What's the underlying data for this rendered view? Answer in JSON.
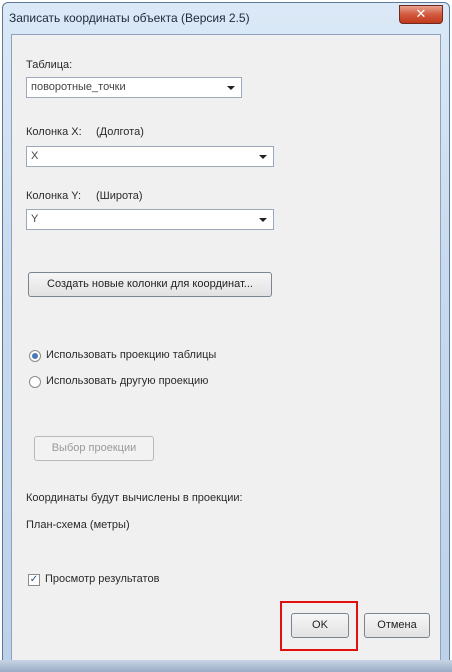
{
  "window": {
    "title": "Записать координаты объекта (Версия 2.5)",
    "close_glyph": "✕"
  },
  "table_section": {
    "label": "Таблица:",
    "selected": "поворотные_точки"
  },
  "column_x": {
    "label": "Колонка X:",
    "hint": "(Долгота)",
    "selected": "X"
  },
  "column_y": {
    "label": "Колонка Y:",
    "hint": "(Широта)",
    "selected": "Y"
  },
  "create_columns_button": "Создать новые колонки для координат...",
  "projection": {
    "use_table": "Использовать проекцию таблицы",
    "use_other": "Использовать другую проекцию",
    "selected": "use_table",
    "select_button": "Выбор проекции"
  },
  "info": {
    "computed_in": "Координаты будут вычислены в проекции:",
    "projection_name": "План-схема (метры)"
  },
  "preview": {
    "label": "Просмотр результатов",
    "checked": true,
    "check_glyph": "✓"
  },
  "buttons": {
    "ok": "OK",
    "cancel": "Отмена"
  },
  "colors": {
    "highlight": "#e01010",
    "radio_selected": "#4a79b8"
  }
}
